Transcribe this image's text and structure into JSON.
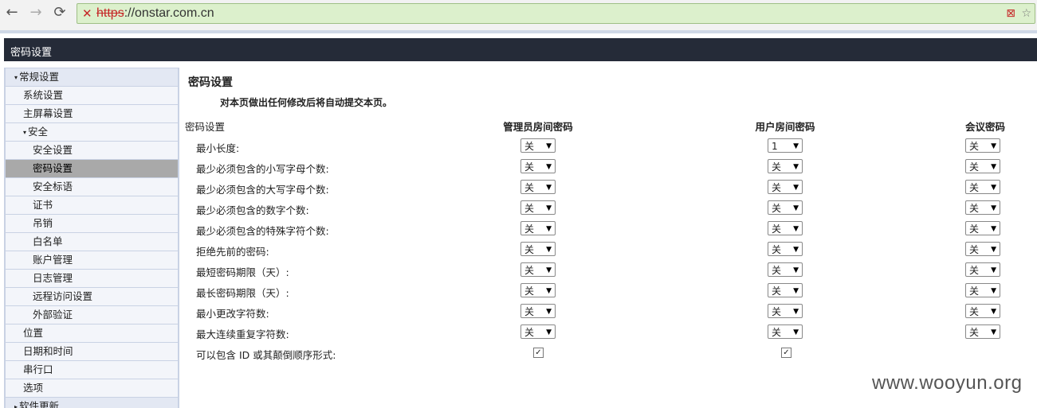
{
  "browser": {
    "url_scheme": "https",
    "url_rest": "://onstar.com.cn",
    "icons": {
      "back": "back-arrow-icon",
      "forward": "forward-arrow-icon",
      "reload": "reload-icon",
      "insecure": "insecure-lock-icon",
      "blocked": "blocked-content-icon",
      "star": "bookmark-star-icon"
    }
  },
  "header": {
    "title": "密码设置"
  },
  "sidebar": {
    "items": [
      {
        "label": "常规设置",
        "level": 0,
        "caret": "▾"
      },
      {
        "label": "系统设置",
        "level": 1
      },
      {
        "label": "主屏幕设置",
        "level": 1
      },
      {
        "label": "安全",
        "level": 1,
        "caret": "▾"
      },
      {
        "label": "安全设置",
        "level": 2
      },
      {
        "label": "密码设置",
        "level": 2,
        "active": true
      },
      {
        "label": "安全标语",
        "level": 2
      },
      {
        "label": "证书",
        "level": 2
      },
      {
        "label": "吊销",
        "level": 2
      },
      {
        "label": "白名单",
        "level": 2
      },
      {
        "label": "账户管理",
        "level": 2
      },
      {
        "label": "日志管理",
        "level": 2
      },
      {
        "label": "远程访问设置",
        "level": 2
      },
      {
        "label": "外部验证",
        "level": 2
      },
      {
        "label": "位置",
        "level": 1
      },
      {
        "label": "日期和时间",
        "level": 1
      },
      {
        "label": "串行口",
        "level": 1
      },
      {
        "label": "选项",
        "level": 1
      },
      {
        "label": "软件更新",
        "level": 0,
        "caret": "▸"
      }
    ]
  },
  "main": {
    "title": "密码设置",
    "notice": "对本页做出任何修改后将自动提交本页。",
    "columns": {
      "label": "密码设置",
      "admin": "管理员房间密码",
      "user": "用户房间密码",
      "meeting": "会议密码"
    },
    "rows": [
      {
        "label": "最小长度:",
        "admin": "关",
        "user": "1",
        "meeting": "关"
      },
      {
        "label": "最少必须包含的小写字母个数:",
        "admin": "关",
        "user": "关",
        "meeting": "关"
      },
      {
        "label": "最少必须包含的大写字母个数:",
        "admin": "关",
        "user": "关",
        "meeting": "关"
      },
      {
        "label": "最少必须包含的数字个数:",
        "admin": "关",
        "user": "关",
        "meeting": "关"
      },
      {
        "label": "最少必须包含的特殊字符个数:",
        "admin": "关",
        "user": "关",
        "meeting": "关"
      },
      {
        "label": "拒绝先前的密码:",
        "admin": "关",
        "user": "关",
        "meeting": "关"
      },
      {
        "label": "最短密码期限（天）:",
        "admin": "关",
        "user": "关",
        "meeting": "关"
      },
      {
        "label": "最长密码期限（天）:",
        "admin": "关",
        "user": "关",
        "meeting": "关"
      },
      {
        "label": "最小更改字符数:",
        "admin": "关",
        "user": "关",
        "meeting": "关"
      },
      {
        "label": "最大连续重复字符数:",
        "admin": "关",
        "user": "关",
        "meeting": "关"
      }
    ],
    "checkbox_row": {
      "label": "可以包含 ID 或其颠倒顺序形式:",
      "admin_checked": true,
      "user_checked": true,
      "mark": "☑"
    }
  },
  "watermark": "www.wooyun.org"
}
